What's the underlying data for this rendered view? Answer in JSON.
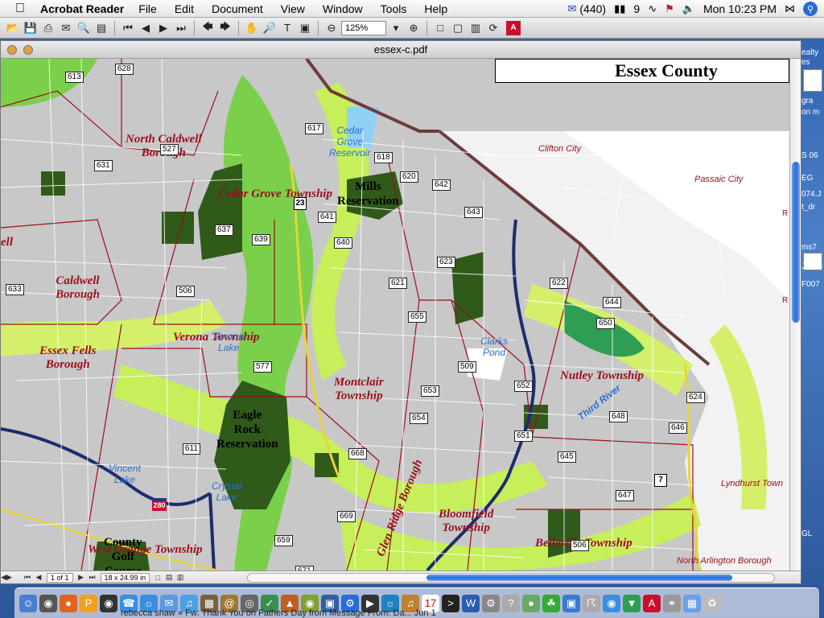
{
  "menubar": {
    "app_name": "Acrobat Reader",
    "menus": [
      "File",
      "Edit",
      "Document",
      "View",
      "Window",
      "Tools",
      "Help"
    ],
    "mail_count": "(440)",
    "extra": "9",
    "clock": "Mon 10:23 PM"
  },
  "toolbar": {
    "zoom": "125%"
  },
  "window": {
    "title": "essex-c.pdf"
  },
  "map": {
    "county_title": "Essex County",
    "towns": [
      {
        "name": "North Caldwell\nBorough"
      },
      {
        "name": "Cedar Grove Township"
      },
      {
        "name": "Caldwell\nBorough"
      },
      {
        "name": "Verona Township"
      },
      {
        "name": "Essex Fells\nBorough"
      },
      {
        "name": "Montclair\nTownship"
      },
      {
        "name": "Nutley Township"
      },
      {
        "name": "Bloomfield\nTownship"
      },
      {
        "name": "Belleville Township"
      },
      {
        "name": "West Orange Township"
      },
      {
        "name": "ell"
      }
    ],
    "glen_ridge": "Glen Ridge Borough",
    "reserves": [
      {
        "name": "Mills\nReservation"
      },
      {
        "name": "Eagle\nRock\nReservation"
      },
      {
        "name": "County\nGolf\nCourse"
      }
    ],
    "cities": [
      "Clifton City",
      "Passaic City",
      "Lyndhurst Town",
      "North Arlington Borough"
    ],
    "waters": [
      {
        "name": "Cedar\nGrove\nReservoir"
      },
      {
        "name": "Verona\nLake"
      },
      {
        "name": "Clarks\nPond"
      },
      {
        "name": "Vincent\nLake"
      },
      {
        "name": "Crystal\nLake"
      },
      {
        "name": "Third River"
      }
    ],
    "routes": [
      "613",
      "628",
      "527",
      "631",
      "617",
      "618",
      "620",
      "642",
      "643",
      "23",
      "641",
      "640",
      "637",
      "639",
      "633",
      "506",
      "623",
      "621",
      "622",
      "644",
      "650",
      "655",
      "577",
      "509",
      "652",
      "653",
      "654",
      "648",
      "646",
      "624",
      "611",
      "651",
      "645",
      "668",
      "669",
      "659",
      "647",
      "7",
      "506",
      "671",
      "672",
      "280"
    ]
  },
  "status": {
    "page": "1 of 1",
    "size": "18 x 24.99 in"
  },
  "desktop": {
    "labels": [
      "ealty",
      "es",
      "gra",
      "on m",
      "S 06",
      "EG",
      "074.J",
      "t_dr",
      "R",
      "ms7",
      "JPEG",
      "F007",
      "R",
      "GL"
    ]
  },
  "dock": {
    "text": "rebecca shaw        » Fw: Thank You on Fathers Day from                                       Message From: Da...              Jun 1"
  }
}
